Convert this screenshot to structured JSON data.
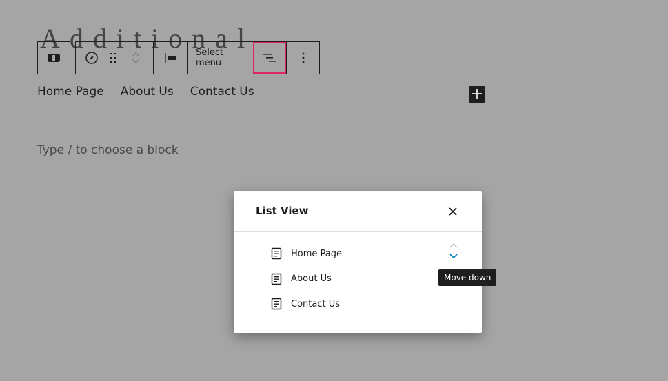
{
  "site_title": "Additional",
  "toolbar": {
    "select_menu_label": "Select menu",
    "buttons": [
      {
        "name": "block-type",
        "icon": "navigation-block-icon"
      },
      {
        "name": "navigation",
        "icon": "compass-icon"
      },
      {
        "name": "drag",
        "icon": "drag-handle-icon"
      },
      {
        "name": "move-up",
        "icon": "chevron-up-icon"
      },
      {
        "name": "move-down",
        "icon": "chevron-down-icon"
      },
      {
        "name": "justification",
        "icon": "justify-left-icon"
      },
      {
        "name": "list-view",
        "icon": "list-view-icon",
        "active": true
      },
      {
        "name": "options",
        "icon": "more-vertical-icon"
      }
    ],
    "active_outline_color": "#e0245e"
  },
  "nav": {
    "items": [
      "Home Page",
      "About Us",
      "Contact Us"
    ]
  },
  "add_block_icon": "plus-icon",
  "placeholder": "Type / to choose a block",
  "list_view": {
    "title": "List View",
    "close_icon": "close-icon",
    "items": [
      {
        "label": "Home Page",
        "icon": "page-icon"
      },
      {
        "label": "About Us",
        "icon": "page-icon"
      },
      {
        "label": "Contact Us",
        "icon": "page-icon"
      }
    ],
    "accent_color": "#007cba"
  },
  "tooltip": "Move down"
}
